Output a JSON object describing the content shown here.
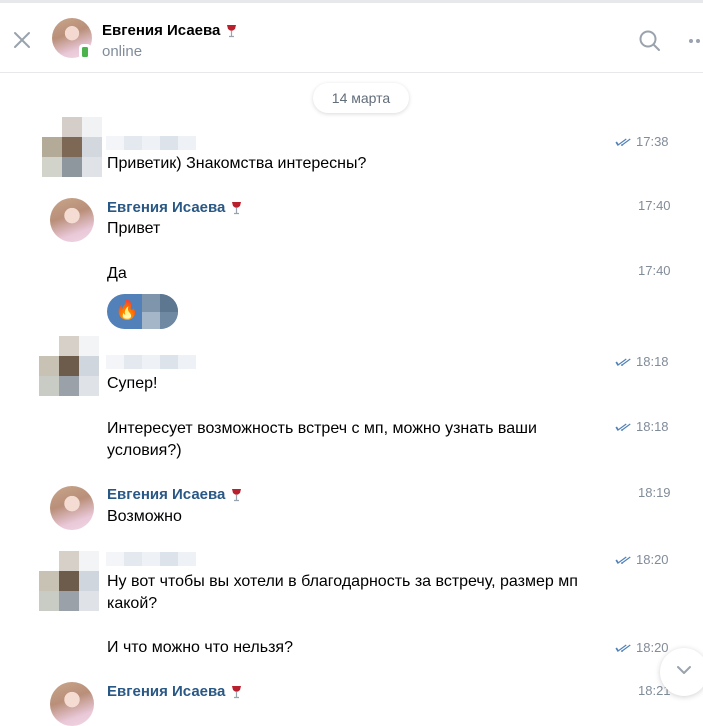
{
  "header": {
    "name": "Евгения Исаева",
    "status": "online",
    "name_emoji": "wine-glass-icon"
  },
  "date_separator": "14 марта",
  "messages": [
    {
      "sender": "",
      "text": "Приветик) Знакомства интересны?",
      "time": "17:38",
      "read": true
    },
    {
      "sender": "Евгения Исаева",
      "text": "Привет",
      "time": "17:40"
    },
    {
      "sender": "",
      "text": "Да",
      "time": "17:40"
    },
    {
      "sender": "",
      "text": "Супер!",
      "time": "18:18",
      "read": true
    },
    {
      "sender": "",
      "text": "Интересует возможность встреч с мп, можно узнать ваши условия?)",
      "time": "18:18",
      "read": true
    },
    {
      "sender": "Евгения Исаева",
      "text": "Возможно",
      "time": "18:19"
    },
    {
      "sender": "",
      "text": "Ну вот чтобы вы хотели в благодарность за встречу, размер мп какой?",
      "time": "18:20",
      "read": true
    },
    {
      "sender": "",
      "text": "И что можно что нельзя?",
      "time": "18:20",
      "read": true
    },
    {
      "sender": "Евгения Исаева",
      "text": "",
      "time": "18:21"
    }
  ],
  "reaction": {
    "emoji": "🔥"
  },
  "colors": {
    "accent": "#2a5885",
    "read_check": "#5181b8",
    "secondary_text": "#818c99",
    "online_badge": "#4bb34b"
  }
}
